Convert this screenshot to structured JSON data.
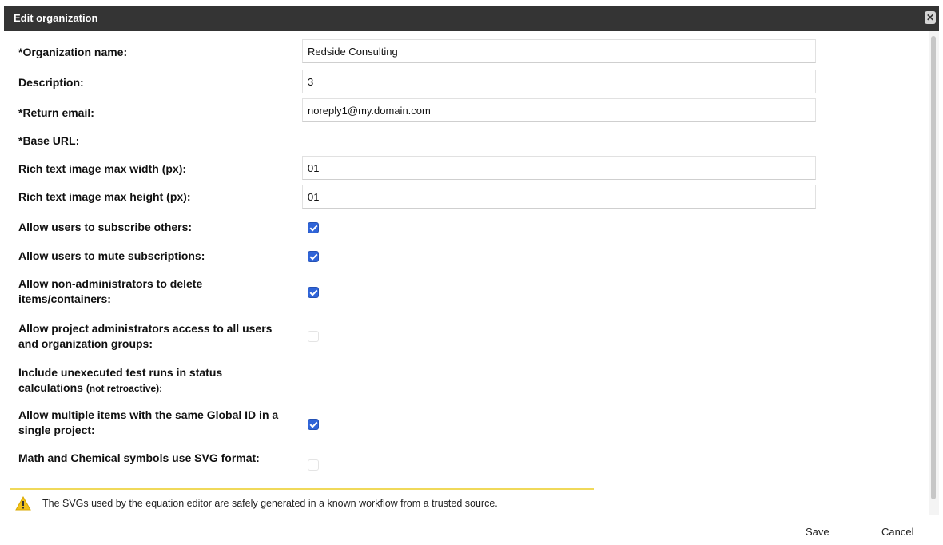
{
  "dialog": {
    "title": "Edit organization",
    "close_icon": "close-icon"
  },
  "fields": {
    "org_name": {
      "label": "*Organization name:",
      "value": "Redside Consulting"
    },
    "description": {
      "label": "Description:",
      "value": "3"
    },
    "return_email": {
      "label": "*Return email:",
      "value": "noreply1@my.domain.com"
    },
    "base_url": {
      "label": "*Base URL:"
    },
    "max_width": {
      "label": "Rich text image max width (px):",
      "value": "01"
    },
    "max_height": {
      "label": "Rich text image max height (px):",
      "value": "01"
    }
  },
  "options": {
    "subscribe_others": {
      "label": "Allow users to subscribe others:",
      "checked": true
    },
    "mute_subscriptions": {
      "label": "Allow users to mute subscriptions:",
      "checked": true
    },
    "nonadmin_delete": {
      "label": "Allow non-administrators to delete items/containers:",
      "checked": true
    },
    "project_admin_access": {
      "label": "Allow project administrators access to all users and organization groups:",
      "checked": false
    },
    "unexecuted_runs": {
      "label": "Include unexecuted test runs in status calculations",
      "note": "(not retroactive):"
    },
    "multiple_global_id": {
      "label": "Allow multiple items with the same Global ID in a single project:",
      "checked": true
    },
    "svg_format": {
      "label": "Math and Chemical symbols use SVG format:",
      "checked": false
    }
  },
  "notice": {
    "icon": "warning-icon",
    "text": "The SVGs used by the equation editor are safely generated in a known workflow from a trusted source."
  },
  "footer": {
    "save": "Save",
    "cancel": "Cancel"
  },
  "colors": {
    "titlebar": "#343434",
    "checkbox": "#2f64d8",
    "notice_border": "#f0d95a"
  }
}
